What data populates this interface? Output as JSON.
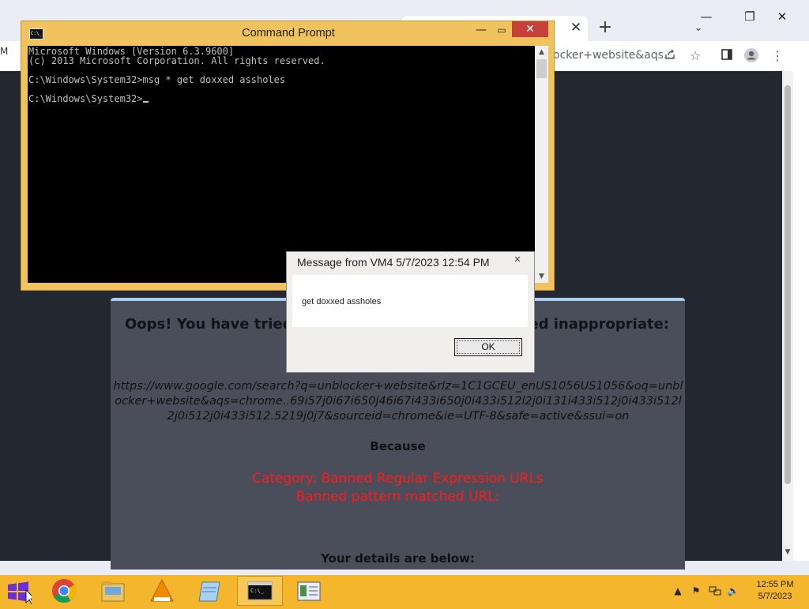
{
  "chrome": {
    "url_fragment": "ocker+website&aqs...",
    "side_letter": "M"
  },
  "blocked_page": {
    "heading_left": "Oops! You have tried vi",
    "heading_right": "emed inappropriate:",
    "url": "https://www.google.com/search?q=unblocker+website&rlz=1C1GCEU_enUS1056US1056&oq=unblocker+website&aqs=chrome..69i57j0i67i650j46i67i433i650j0i433i512l2j0i131i433i512j0i433i512l2j0i512j0i433i512.5219j0j7&sourceid=chrome&ie=UTF-8&safe=active&ssui=on",
    "because": "Because",
    "category_line1": "Category: Banned Regular Expression URLs",
    "category_line2": "Banned pattern matched URL:",
    "details": "Your details are below:"
  },
  "cmd": {
    "title": "Command Prompt",
    "lines": [
      "Microsoft Windows [Version 6.3.9600]",
      "(c) 2013 Microsoft Corporation. All rights reserved.",
      "",
      "C:\\Windows\\System32>msg * get doxxed assholes",
      "",
      "C:\\Windows\\System32>"
    ]
  },
  "message": {
    "title": "Message from VM4 5/7/2023 12:54 PM",
    "text": "get doxxed assholes",
    "ok_label": "OK"
  },
  "taskbar": {
    "time": "12:55 PM",
    "date": "5/7/2023",
    "apps": [
      "chrome-icon",
      "file-explorer-icon",
      "vlc-icon",
      "notepad-icon",
      "cmd-icon",
      "control-panel-icon"
    ]
  },
  "colors": {
    "taskbar": "#f4b62c",
    "cmd_close": "#c7403a",
    "category_red": "#ff1a1a"
  }
}
